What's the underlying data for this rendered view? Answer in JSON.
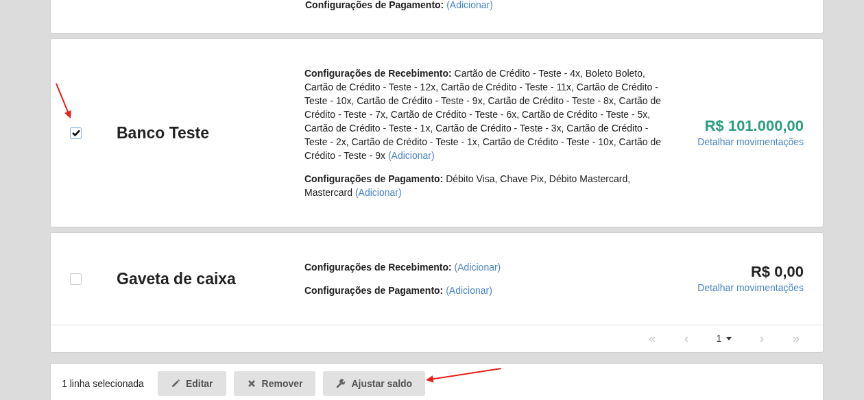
{
  "partial_account": {
    "payment_label": "Configurações de Pagamento:",
    "payment_link": "(Adicionar)"
  },
  "accounts": [
    {
      "name": "Banco Teste",
      "selected": true,
      "receiving_label": "Configurações de Recebimento:",
      "receiving_value": "Cartão de Crédito - Teste - 4x, Boleto Boleto, Cartão de Crédito - Teste - 12x, Cartão de Crédito - Teste - 11x, Cartão de Crédito - Teste - 10x, Cartão de Crédito - Teste - 9x, Cartão de Crédito - Teste - 8x, Cartão de Crédito - Teste - 7x, Cartão de Crédito - Teste - 6x, Cartão de Crédito - Teste - 5x, Cartão de Crédito - Teste - 1x, Cartão de Crédito - Teste - 3x, Cartão de Crédito - Teste - 2x, Cartão de Crédito - Teste - 1x, Cartão de Crédito - Teste - 10x, Cartão de Crédito - Teste - 9x",
      "receiving_link": "(Adicionar)",
      "payment_label": "Configurações de Pagamento:",
      "payment_value": "Débito Visa, Chave Pix, Débito Mastercard, Mastercard",
      "payment_link": "(Adicionar)",
      "balance": "R$ 101.000,00",
      "balance_positive": true,
      "details_link": "Detalhar movimentações"
    },
    {
      "name": "Gaveta de caixa",
      "selected": false,
      "receiving_label": "Configurações de Recebimento:",
      "receiving_link": "(Adicionar)",
      "payment_label": "Configurações de Pagamento:",
      "payment_link": "(Adicionar)",
      "balance": "R$ 0,00",
      "balance_positive": false,
      "details_link": "Detalhar movimentações"
    }
  ],
  "pager": {
    "page": "1",
    "buttons": [
      {
        "label": "«",
        "disabled": true
      },
      {
        "label": "‹",
        "disabled": true
      },
      {
        "label": "›",
        "disabled": true
      },
      {
        "label": "»",
        "disabled": true
      }
    ]
  },
  "action_bar": {
    "selection_text": "1 linha selecionada",
    "buttons": [
      {
        "label": "Editar",
        "kind": "pencil"
      },
      {
        "label": "Remover",
        "kind": "times"
      },
      {
        "label": "Ajustar saldo",
        "kind": "wrench"
      }
    ]
  }
}
